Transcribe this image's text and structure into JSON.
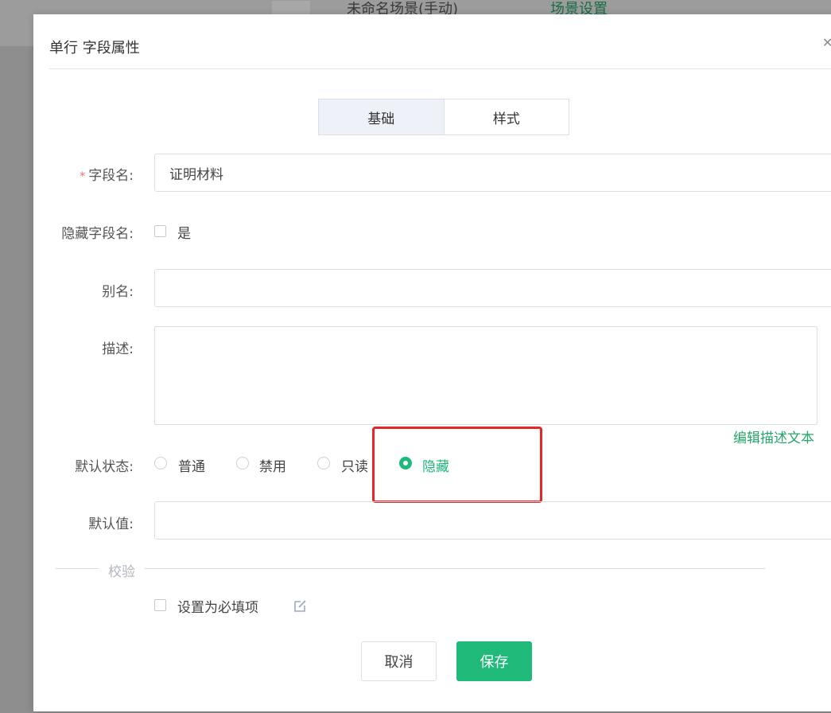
{
  "background": {
    "title_text": "未命名场景(手动)",
    "link_text": "场景设置"
  },
  "modal": {
    "title": "单行 字段属性",
    "close_icon": "close-icon"
  },
  "tabs": [
    {
      "label": "基础",
      "active": true
    },
    {
      "label": "样式",
      "active": false
    }
  ],
  "form": {
    "field_name": {
      "required_mark": "*",
      "label": "字段名:",
      "value": "证明材料"
    },
    "hide_field_name": {
      "label": "隐藏字段名:",
      "option_label": "是",
      "checked": false
    },
    "alias": {
      "label": "别名:",
      "value": ""
    },
    "description": {
      "label": "描述:",
      "value": "",
      "edit_link": "编辑描述文本"
    },
    "default_state": {
      "label": "默认状态:",
      "options": [
        {
          "label": "普通",
          "checked": false
        },
        {
          "label": "禁用",
          "checked": false
        },
        {
          "label": "只读",
          "checked": false
        },
        {
          "label": "隐藏",
          "checked": true
        }
      ]
    },
    "default_value": {
      "label": "默认值:",
      "value": ""
    }
  },
  "validation": {
    "section_title": "校验",
    "required_label": "设置为必填项",
    "required_checked": false,
    "edit_icon": "edit-icon"
  },
  "footer": {
    "cancel_label": "取消",
    "save_label": "保存"
  },
  "colors": {
    "accent": "#1fb97a",
    "highlight": "#e5262a",
    "required": "#f56c6c"
  }
}
